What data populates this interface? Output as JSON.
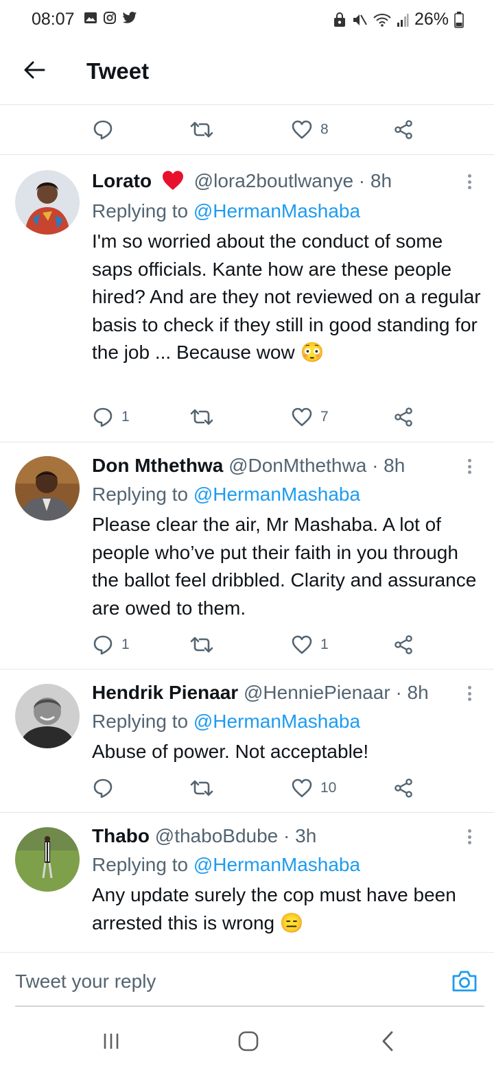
{
  "status_bar": {
    "time": "08:07",
    "battery": "26%"
  },
  "header": {
    "title": "Tweet"
  },
  "top_actions": {
    "like_count": "8"
  },
  "tweets": [
    {
      "name": "Lorato",
      "handle": "@lora2boutlwanye",
      "time": "· 8h",
      "replying_label": "Replying to",
      "replying_to": "@HermanMashaba",
      "text": "I'm so worried about the conduct of some saps officials. Kante how are these people hired? And are they not reviewed on a regular basis to check if they still in good standing for the job ... Because wow",
      "emoji": "😳",
      "reply_count": "1",
      "like_count": "7"
    },
    {
      "name": "Don Mthethwa",
      "handle": "@DonMthethwa",
      "time": "· 8h",
      "replying_label": "Replying to",
      "replying_to": "@HermanMashaba",
      "text": "Please clear the air, Mr Mashaba. A lot of people who’ve put their faith in you through the ballot feel dribbled. Clarity and assurance are owed to them.",
      "reply_count": "1",
      "like_count": "1"
    },
    {
      "name": "Hendrik Pienaar",
      "handle": "@HenniePienaar",
      "time": "· 8h",
      "replying_label": "Replying to",
      "replying_to": "@HermanMashaba",
      "text": "Abuse of power. Not acceptable!",
      "like_count": "10"
    },
    {
      "name": "Thabo",
      "handle": "@thaboBdube",
      "time": "· 3h",
      "replying_label": "Replying to",
      "replying_to": "@HermanMashaba",
      "text": "Any update surely the cop must have been arrested this is wrong",
      "emoji": "😑"
    }
  ],
  "reply_bar": {
    "placeholder": "Tweet your reply"
  },
  "colors": {
    "accent": "#1d9bf0",
    "heart": "#e8112d",
    "muted": "#536471"
  }
}
